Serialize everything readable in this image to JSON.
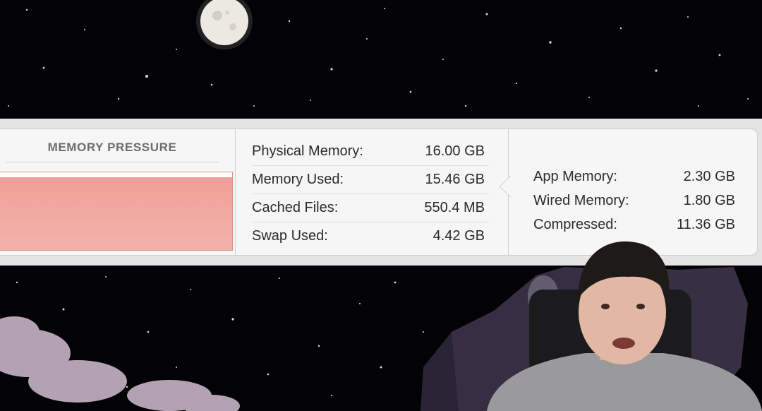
{
  "memory_panel": {
    "pressure": {
      "title": "MEMORY PRESSURE",
      "level_fraction": 0.94,
      "color": "#ef9f95"
    },
    "stats": [
      {
        "label": "Physical Memory:",
        "value": "16.00 GB"
      },
      {
        "label": "Memory Used:",
        "value": "15.46 GB"
      },
      {
        "label": "Cached Files:",
        "value": "550.4 MB"
      },
      {
        "label": "Swap Used:",
        "value": "4.42 GB"
      }
    ],
    "details": [
      {
        "label": "App Memory:",
        "value": "2.30 GB"
      },
      {
        "label": "Wired Memory:",
        "value": "1.80 GB"
      },
      {
        "label": "Compressed:",
        "value": "11.36 GB"
      }
    ]
  }
}
